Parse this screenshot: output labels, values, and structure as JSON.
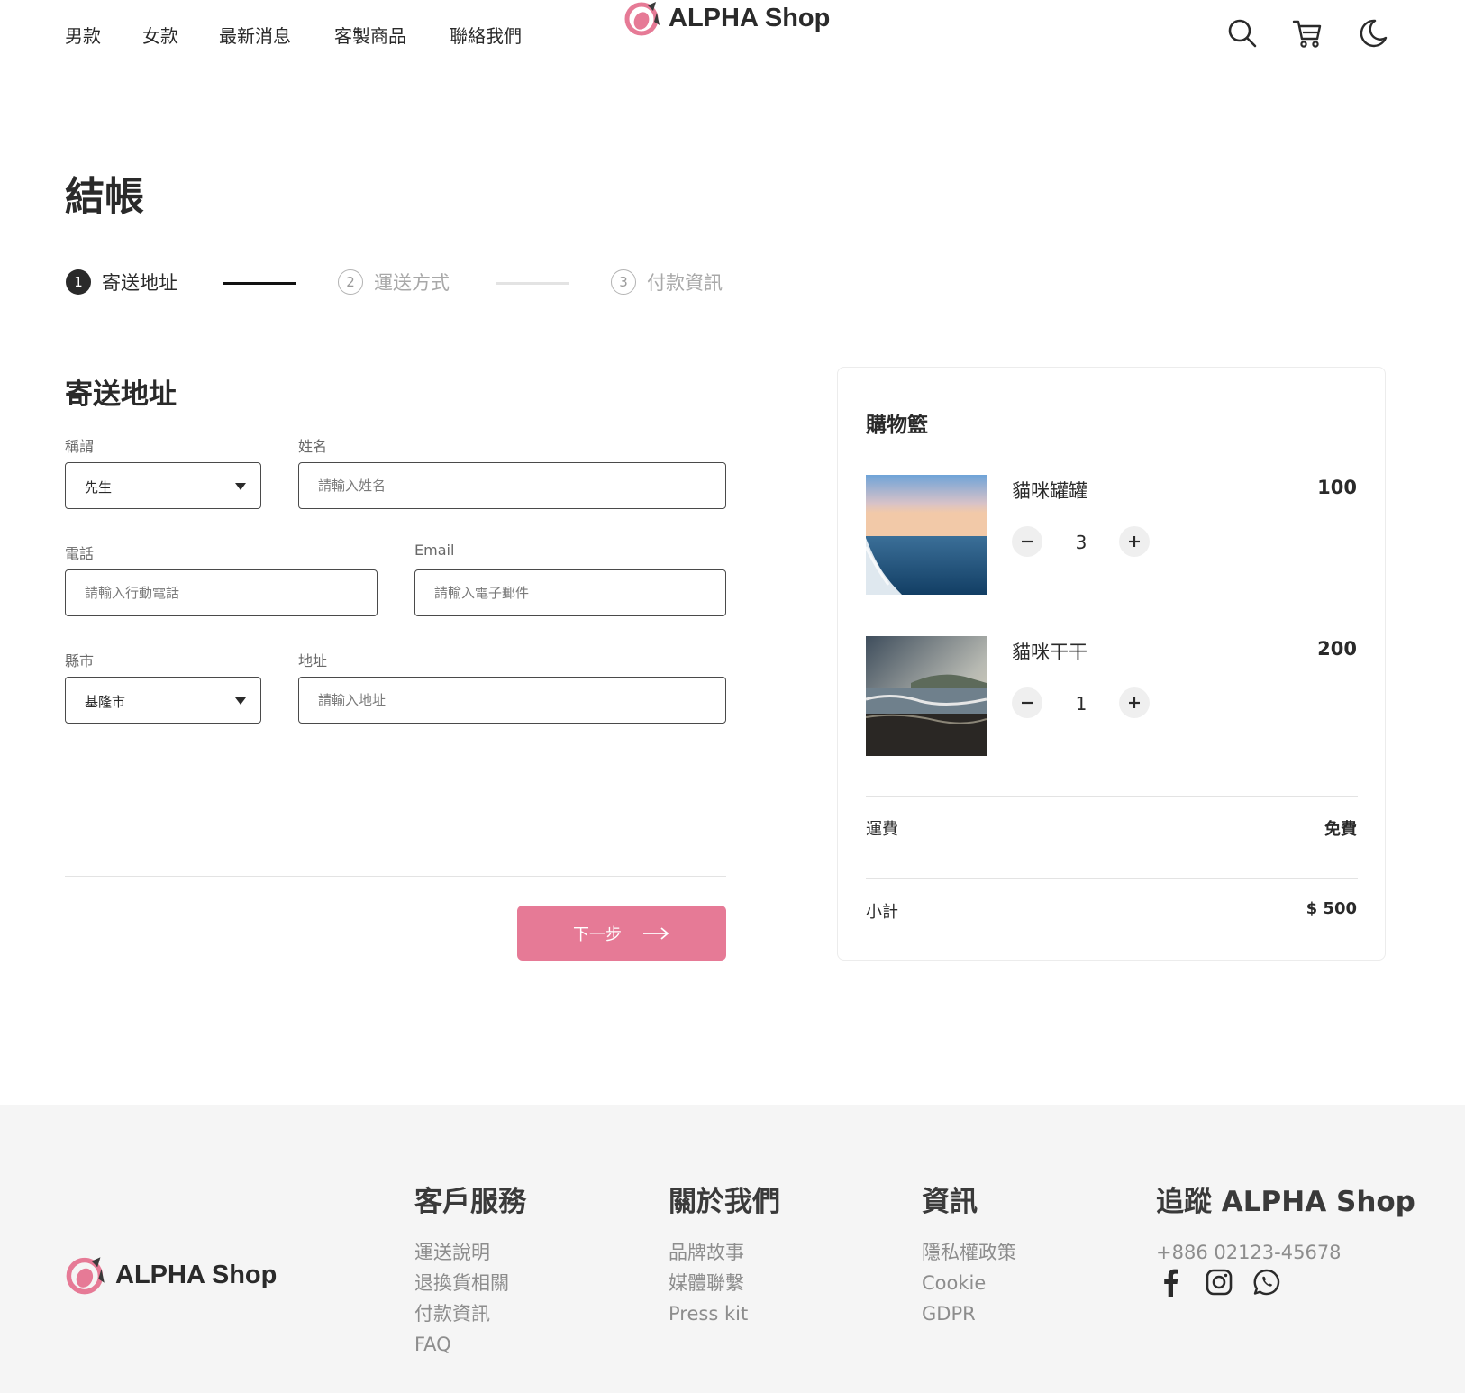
{
  "header": {
    "nav": [
      "男款",
      "女款",
      "最新消息",
      "客製商品",
      "聯絡我們"
    ],
    "brand": "ALPHA Shop",
    "icons": [
      "search-icon",
      "cart-icon",
      "moon-icon"
    ]
  },
  "page": {
    "title": "結帳"
  },
  "stepper": {
    "steps": [
      {
        "number": "1",
        "label": "寄送地址",
        "state": "active"
      },
      {
        "number": "2",
        "label": "運送方式",
        "state": "inactive"
      },
      {
        "number": "3",
        "label": "付款資訊",
        "state": "inactive"
      }
    ]
  },
  "form": {
    "title": "寄送地址",
    "salutation": {
      "label": "稱謂",
      "value": "先生"
    },
    "name": {
      "label": "姓名",
      "placeholder": "請輸入姓名"
    },
    "phone": {
      "label": "電話",
      "placeholder": "請輸入行動電話"
    },
    "email": {
      "label": "Email",
      "placeholder": "請輸入電子郵件"
    },
    "city": {
      "label": "縣市",
      "value": "基隆市"
    },
    "address": {
      "label": "地址",
      "placeholder": "請輸入地址"
    },
    "next_label": "下一步"
  },
  "cart": {
    "title": "購物籃",
    "items": [
      {
        "name": "貓咪罐罐",
        "price": "100",
        "quantity": "3"
      },
      {
        "name": "貓咪干干",
        "price": "200",
        "quantity": "1"
      }
    ],
    "shipping": {
      "label": "運費",
      "value": "免費"
    },
    "subtotal": {
      "label": "小計",
      "value": "$ 500"
    }
  },
  "footer": {
    "brand": "ALPHA Shop",
    "columns": [
      {
        "title": "客戶服務",
        "links": [
          "運送說明",
          "退換貨相關",
          "付款資訊",
          "FAQ"
        ]
      },
      {
        "title": "關於我們",
        "links": [
          "品牌故事",
          "媒體聯繫",
          "Press kit"
        ]
      },
      {
        "title": "資訊",
        "links": [
          "隱私權政策",
          "Cookie",
          "GDPR"
        ]
      }
    ],
    "follow": {
      "title": "追蹤 ALPHA Shop",
      "phone": "+886 02123-45678",
      "social": [
        "facebook-icon",
        "instagram-icon",
        "whatsapp-icon"
      ]
    }
  },
  "colors": {
    "accent": "#e67a96",
    "text": "#2a2a2a",
    "muted": "#8d8d8d",
    "footer_bg": "#f5f5f5"
  }
}
